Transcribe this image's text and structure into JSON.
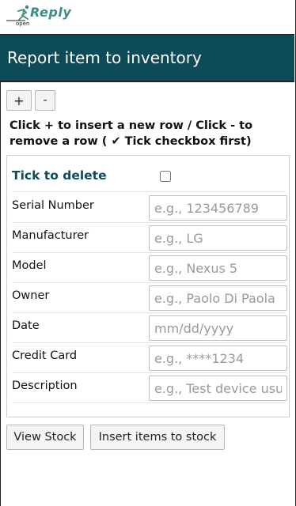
{
  "header": {
    "logo_text": "Reply",
    "logo_sub": "open",
    "logo_icon": "runner-icon"
  },
  "page": {
    "title": "Report item to inventory"
  },
  "row_controls": {
    "add_label": "+",
    "remove_label": "-"
  },
  "instructions": "Click + to insert a new row / Click - to remove a row ( ✔ Tick checkbox first)",
  "form": {
    "tick_label": "Tick to delete",
    "fields": [
      {
        "label": "Serial Number",
        "placeholder": "e.g., 123456789"
      },
      {
        "label": "Manufacturer",
        "placeholder": "e.g., LG"
      },
      {
        "label": "Model",
        "placeholder": "e.g., Nexus 5"
      },
      {
        "label": "Owner",
        "placeholder": "e.g., Paolo Di Paola"
      },
      {
        "label": "Date",
        "placeholder": "mm/dd/yyyy"
      },
      {
        "label": "Credit Card",
        "placeholder": "e.g., ****1234"
      },
      {
        "label": "Description",
        "placeholder": "e.g., Test device usua"
      }
    ]
  },
  "actions": {
    "view_stock": "View Stock",
    "insert_items": "Insert items to stock"
  },
  "colors": {
    "title_bar_bg": "#0d4b59",
    "accent": "#3b8c86"
  }
}
